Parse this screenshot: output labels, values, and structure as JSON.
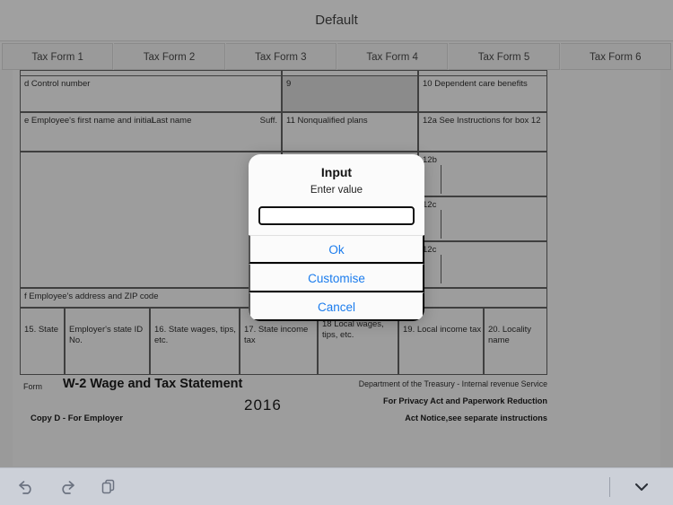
{
  "titlebar": {
    "title": "Default"
  },
  "tabs": [
    {
      "label": "Tax Form 1"
    },
    {
      "label": "Tax Form 2"
    },
    {
      "label": "Tax Form 3"
    },
    {
      "label": "Tax Form 4"
    },
    {
      "label": "Tax Form 5"
    },
    {
      "label": "Tax Form 6"
    }
  ],
  "form": {
    "boxes": {
      "control_number": "d Control number",
      "box9": "9",
      "box10": "10 Dependent care benefits",
      "employee_name": "e Employee's first name and initial",
      "last_name": "Last name",
      "suffix": "Suff.",
      "box11": "11 Nonqualified plans",
      "box12a": "12a See Instructions for box 12",
      "box12b": "12b",
      "box12c1": "12c",
      "box12c2": "12c",
      "address": "f Employee's address and ZIP code",
      "box15": "15. State",
      "state_id": "Employer's state ID No.",
      "box16": "16. State wages, tips, etc.",
      "box17": "17. State income tax",
      "box18": "18 Local wages, tips, etc.",
      "box19": "19. Local income tax",
      "box20": "20. Locality name"
    },
    "footer": {
      "form_word": "Form",
      "title": "W-2 Wage and Tax Statement",
      "year": "2016",
      "department": "Department of the Treasury - Internal revenue Service",
      "privacy_line1": "For Privacy Act and Paperwork Reduction",
      "privacy_line2": "Act Notice,see separate instructions",
      "copy": "Copy D -   For Employer"
    }
  },
  "dialog": {
    "title": "Input",
    "message": "Enter value",
    "input_value": "",
    "input_placeholder": "",
    "buttons": {
      "ok": "Ok",
      "customise": "Customise",
      "cancel": "Cancel"
    },
    "accent_color": "#1b7ced"
  },
  "toolbar": {
    "undo": "undo-icon",
    "redo": "redo-icon",
    "copy": "copy-icon",
    "collapse": "chevron-down-icon"
  }
}
